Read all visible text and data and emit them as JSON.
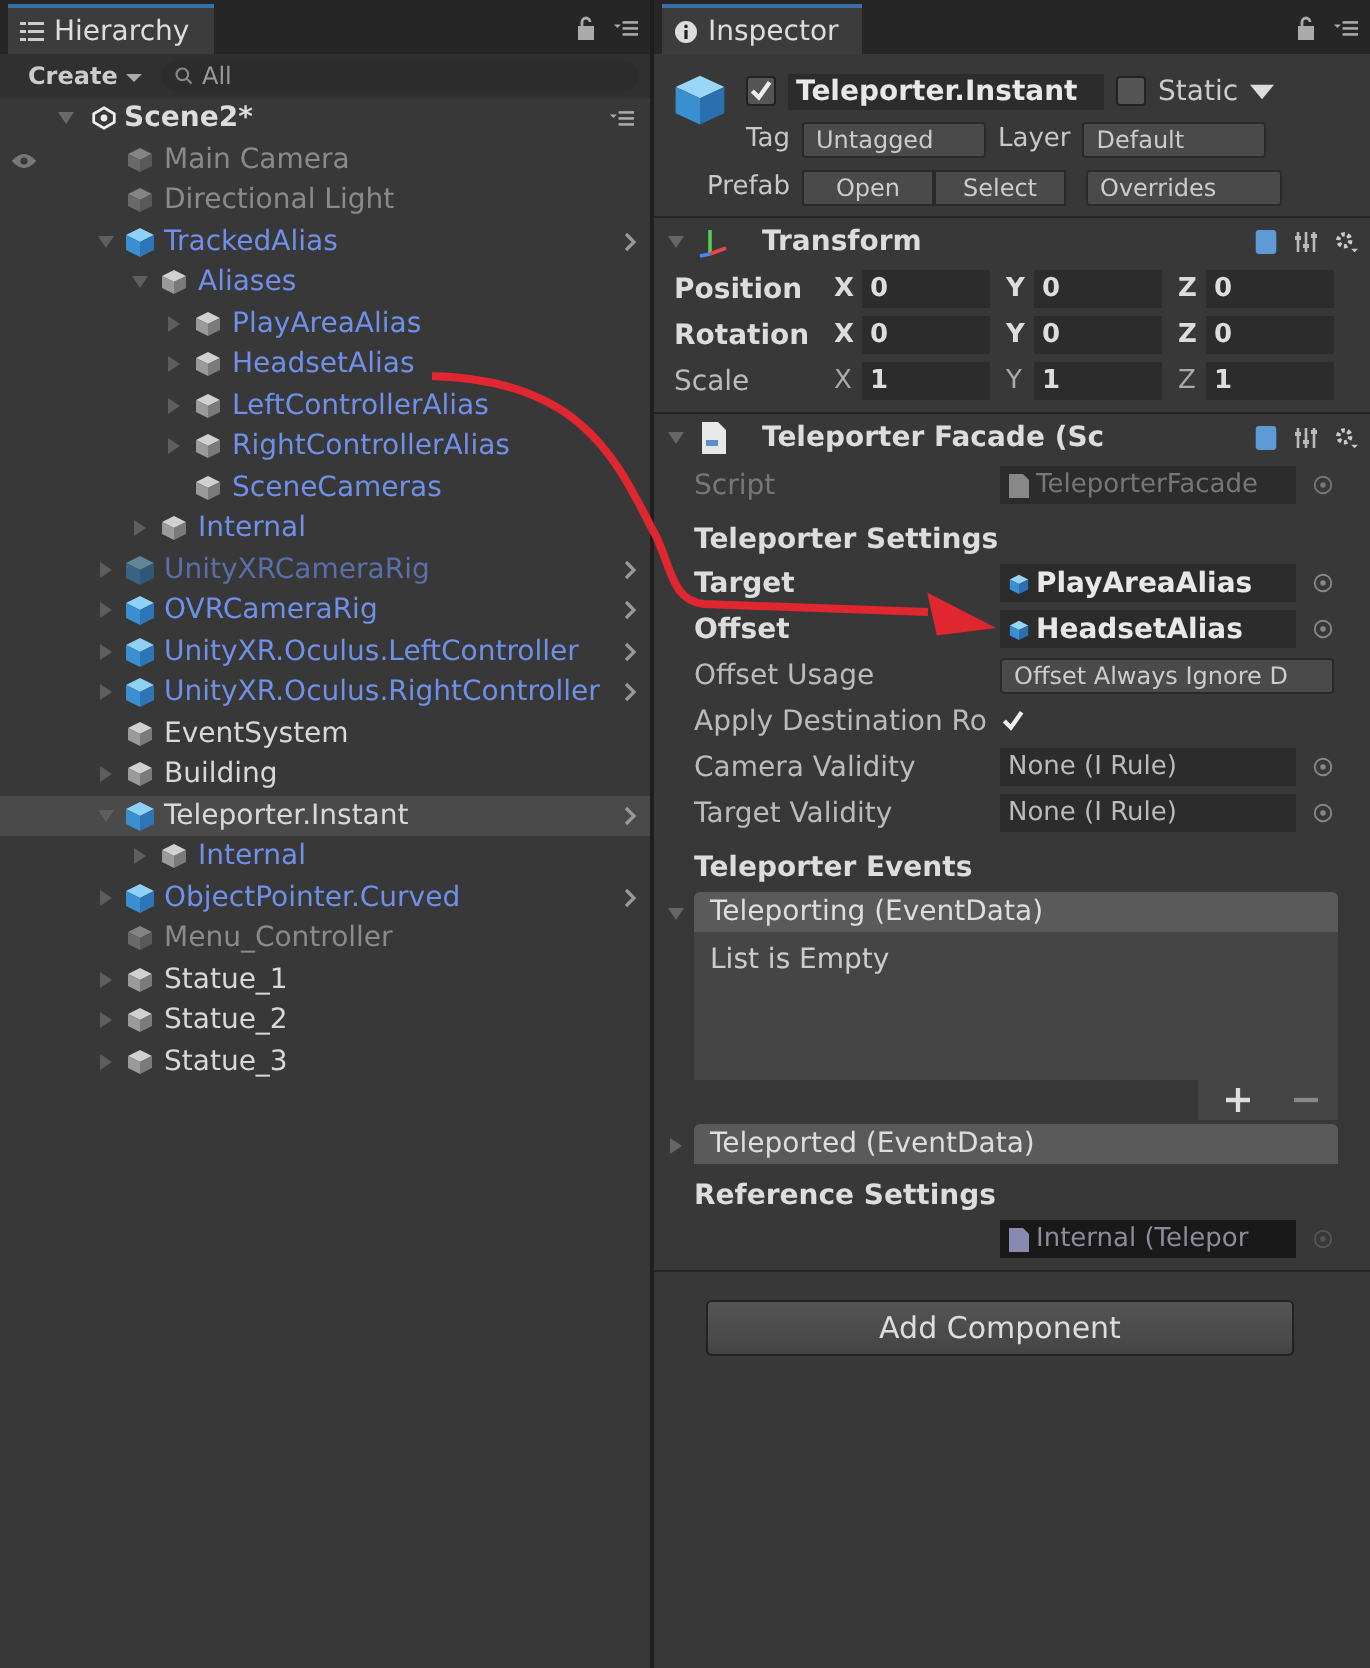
{
  "hierarchy": {
    "tab": "Hierarchy",
    "create": "Create",
    "search": {
      "placeholder": "All"
    },
    "scene": {
      "name": "Scene2*",
      "expanded": true
    },
    "items": [
      {
        "name": "Main Camera",
        "kind": "object",
        "linked": false,
        "active": false,
        "expandable": false,
        "selected": false
      },
      {
        "name": "Directional Light",
        "kind": "object",
        "linked": false,
        "active": false,
        "expandable": false,
        "selected": false
      },
      {
        "name": "TrackedAlias",
        "kind": "prefab",
        "linked": true,
        "active": true,
        "expandable": true,
        "expanded": true,
        "selected": false,
        "children": [
          {
            "name": "Aliases",
            "kind": "object",
            "linked": true,
            "active": true,
            "expandable": true,
            "expanded": true,
            "selected": false,
            "children": [
              {
                "name": "PlayAreaAlias",
                "kind": "object",
                "linked": true,
                "active": true,
                "expandable": true,
                "expanded": false,
                "selected": false
              },
              {
                "name": "HeadsetAlias",
                "kind": "object",
                "linked": true,
                "active": true,
                "expandable": true,
                "expanded": false,
                "selected": false
              },
              {
                "name": "LeftControllerAlias",
                "kind": "object",
                "linked": true,
                "active": true,
                "expandable": true,
                "expanded": false,
                "selected": false
              },
              {
                "name": "RightControllerAlias",
                "kind": "object",
                "linked": true,
                "active": true,
                "expandable": true,
                "expanded": false,
                "selected": false
              },
              {
                "name": "SceneCameras",
                "kind": "object",
                "linked": true,
                "active": true,
                "expandable": false,
                "selected": false
              }
            ]
          },
          {
            "name": "Internal",
            "kind": "object",
            "linked": true,
            "active": true,
            "expandable": true,
            "expanded": false,
            "selected": false
          }
        ]
      },
      {
        "name": "UnityXRCameraRig",
        "kind": "prefab",
        "linked": true,
        "active": false,
        "expandable": true,
        "expanded": false,
        "selected": false
      },
      {
        "name": "OVRCameraRig",
        "kind": "prefab",
        "linked": true,
        "active": true,
        "expandable": true,
        "expanded": false,
        "selected": false
      },
      {
        "name": "UnityXR.Oculus.LeftController",
        "kind": "prefab",
        "linked": true,
        "active": true,
        "expandable": true,
        "expanded": false,
        "selected": false
      },
      {
        "name": "UnityXR.Oculus.RightController",
        "kind": "prefab",
        "linked": true,
        "active": true,
        "expandable": true,
        "expanded": false,
        "selected": false
      },
      {
        "name": "EventSystem",
        "kind": "object",
        "linked": false,
        "active": true,
        "expandable": false,
        "selected": false
      },
      {
        "name": "Building",
        "kind": "object",
        "linked": false,
        "active": true,
        "expandable": true,
        "expanded": false,
        "selected": false
      },
      {
        "name": "Teleporter.Instant",
        "kind": "prefab",
        "linked": false,
        "active": true,
        "expandable": true,
        "expanded": true,
        "selected": true,
        "children": [
          {
            "name": "Internal",
            "kind": "object",
            "linked": true,
            "active": true,
            "expandable": true,
            "expanded": false,
            "selected": false
          }
        ]
      },
      {
        "name": "ObjectPointer.Curved",
        "kind": "prefab",
        "linked": true,
        "active": true,
        "expandable": true,
        "expanded": false,
        "selected": false
      },
      {
        "name": "Menu_Controller",
        "kind": "object",
        "linked": false,
        "active": false,
        "expandable": false,
        "selected": false
      },
      {
        "name": "Statue_1",
        "kind": "object",
        "linked": false,
        "active": true,
        "expandable": true,
        "expanded": false,
        "selected": false
      },
      {
        "name": "Statue_2",
        "kind": "object",
        "linked": false,
        "active": true,
        "expandable": true,
        "expanded": false,
        "selected": false
      },
      {
        "name": "Statue_3",
        "kind": "object",
        "linked": false,
        "active": true,
        "expandable": true,
        "expanded": false,
        "selected": false
      }
    ]
  },
  "inspector": {
    "tab": "Inspector",
    "object_name": "Teleporter.Instant",
    "enabled": true,
    "static": {
      "label": "Static",
      "checked": false
    },
    "tag": {
      "label": "Tag",
      "value": "Untagged"
    },
    "layer": {
      "label": "Layer",
      "value": "Default"
    },
    "prefab": {
      "label": "Prefab",
      "buttons": [
        "Open",
        "Select"
      ],
      "overrides": "Overrides"
    },
    "transform": {
      "title": "Transform",
      "expanded": true,
      "rows": [
        {
          "label": "Position",
          "bold": true,
          "values": [
            {
              "axis": "X",
              "value": "0"
            },
            {
              "axis": "Y",
              "value": "0"
            },
            {
              "axis": "Z",
              "value": "0"
            }
          ]
        },
        {
          "label": "Rotation",
          "bold": true,
          "values": [
            {
              "axis": "X",
              "value": "0"
            },
            {
              "axis": "Y",
              "value": "0"
            },
            {
              "axis": "Z",
              "value": "0"
            }
          ]
        },
        {
          "label": "Scale",
          "bold": false,
          "values": [
            {
              "axis": "X",
              "value": "1"
            },
            {
              "axis": "Y",
              "value": "1"
            },
            {
              "axis": "Z",
              "value": "1"
            }
          ]
        }
      ]
    },
    "facade": {
      "title": "Teleporter Facade (Sc",
      "expanded": true,
      "script": {
        "label": "Script",
        "value": "TeleporterFacade"
      },
      "settings_title": "Teleporter Settings",
      "fields": [
        {
          "label": "Target",
          "kind": "object",
          "bold": true,
          "value": "PlayAreaAlias"
        },
        {
          "label": "Offset",
          "kind": "object",
          "bold": true,
          "value": "HeadsetAlias"
        },
        {
          "label": "Offset Usage",
          "kind": "dropdown",
          "bold": false,
          "value": "Offset Always Ignore D"
        },
        {
          "label": "Apply Destination Ro",
          "kind": "checkbox",
          "bold": false,
          "checked": true
        },
        {
          "label": "Camera Validity",
          "kind": "reference",
          "bold": false,
          "value": "None (I Rule)"
        },
        {
          "label": "Target Validity",
          "kind": "reference",
          "bold": false,
          "value": "None (I Rule)"
        }
      ],
      "events_title": "Teleporter Events",
      "events": [
        {
          "title": "Teleporting (EventData)",
          "expanded": true,
          "empty_text": "List is Empty"
        },
        {
          "title": "Teleported (EventData)",
          "expanded": false
        }
      ],
      "reference_title": "Reference Settings",
      "reference_value": "Internal (Telepor"
    },
    "add_component": "Add Component"
  }
}
